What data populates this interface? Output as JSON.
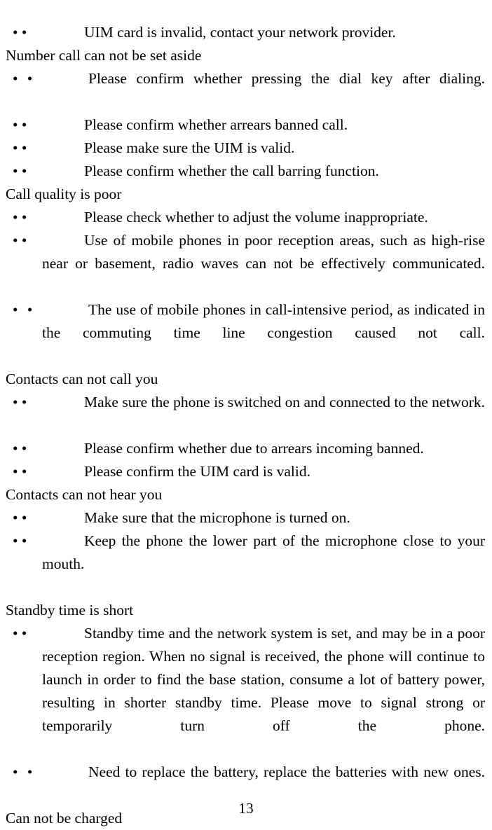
{
  "document": {
    "page_number": "13",
    "bullet_marker": "• •",
    "blocks": [
      {
        "kind": "bullet",
        "text": "UIM card is invalid, contact your network provider."
      },
      {
        "kind": "heading",
        "text": "Number call can not be set aside"
      },
      {
        "kind": "bullet",
        "text": "Please confirm whether pressing the dial key after dialing.",
        "justified": true,
        "wide_marker": true
      },
      {
        "kind": "bullet",
        "text": "Please confirm whether arrears banned call."
      },
      {
        "kind": "bullet",
        "text": "Please make sure the UIM is valid."
      },
      {
        "kind": "bullet",
        "text": "Please confirm whether the call barring function."
      },
      {
        "kind": "heading",
        "text": "Call quality is poor"
      },
      {
        "kind": "bullet",
        "text": "Please check whether to adjust the volume inappropriate."
      },
      {
        "kind": "bullet",
        "text": "Use of mobile phones in poor reception areas, such as high-rise near or basement, radio waves can not be effectively communicated.",
        "justified": true
      },
      {
        "kind": "bullet",
        "text": "The use of mobile phones in call-intensive period, as indicated in the commuting time line congestion caused not call.",
        "justified": true,
        "wide_marker": true
      },
      {
        "kind": "heading",
        "text": "Contacts can not call you"
      },
      {
        "kind": "bullet",
        "text": "Make sure the phone is switched on and connected to the network.",
        "justified": true
      },
      {
        "kind": "bullet",
        "text": "Please confirm whether due to arrears incoming banned."
      },
      {
        "kind": "bullet",
        "text": "Please confirm the UIM card is valid."
      },
      {
        "kind": "heading",
        "text": "Contacts can not hear you"
      },
      {
        "kind": "bullet",
        "text": "Make sure that the microphone is turned on."
      },
      {
        "kind": "bullet",
        "text": "Keep the phone the lower part of the microphone close to your mouth.",
        "justified": true
      },
      {
        "kind": "heading",
        "text": "Standby time is short"
      },
      {
        "kind": "bullet",
        "text": "Standby time and the network system is set, and may be in a poor reception region. When no signal is received, the phone will continue to launch in order to find the base station, consume a lot of battery power, resulting in shorter standby time. Please move to signal strong or temporarily turn off the phone.",
        "justified": true
      },
      {
        "kind": "bullet",
        "text": "Need to replace the battery, replace the batteries with new ones.",
        "justified": true,
        "wide_marker": true
      },
      {
        "kind": "heading",
        "text": "Can not be charged"
      }
    ]
  }
}
